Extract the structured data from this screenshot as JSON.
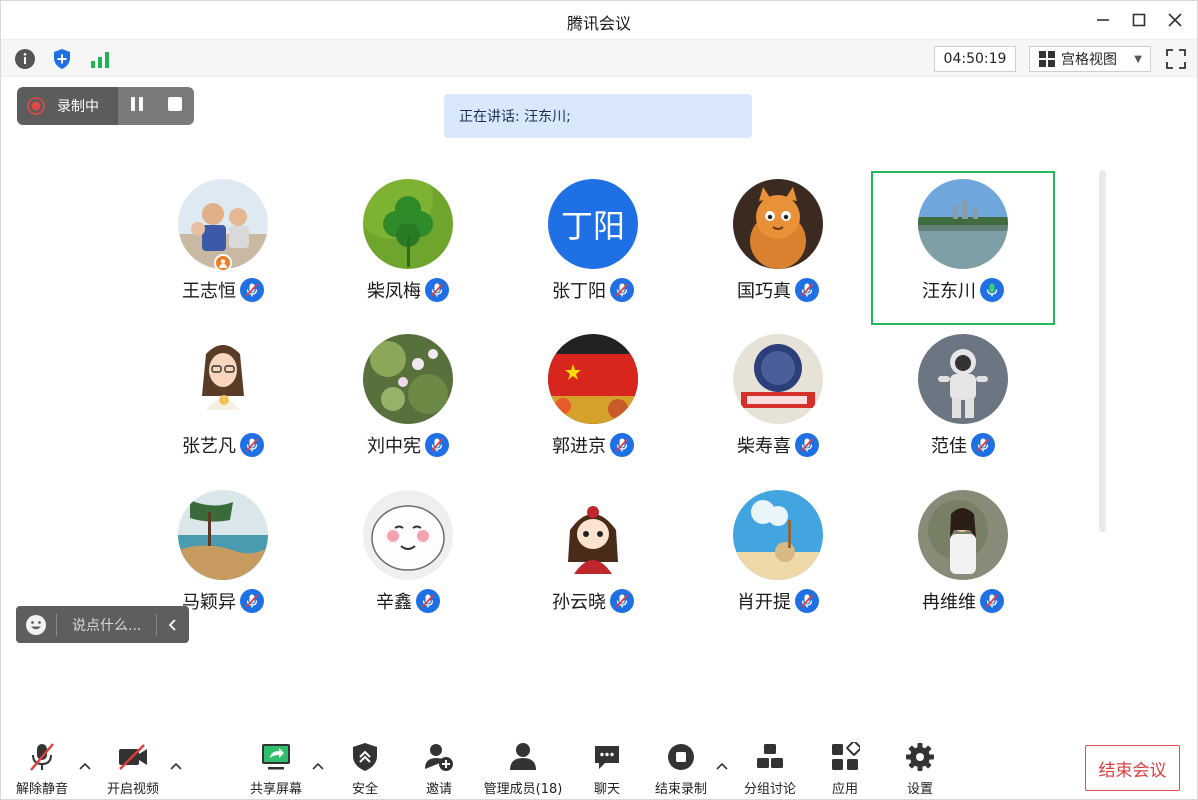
{
  "window": {
    "title": "腾讯会议"
  },
  "toolbar": {
    "timer": "04:50:19",
    "view_mode": "宫格视图"
  },
  "recording": {
    "label": "录制中"
  },
  "speaking": {
    "text": "正在讲话: 汪东川;"
  },
  "participants": [
    {
      "name": "王志恒",
      "avatar": "family-photo",
      "host": true,
      "speaking": false
    },
    {
      "name": "柴凤梅",
      "avatar": "clover",
      "host": false,
      "speaking": false
    },
    {
      "name": "张丁阳",
      "avatar": "text-avatar",
      "avatar_text": "丁阳",
      "host": false,
      "speaking": false
    },
    {
      "name": "国巧真",
      "avatar": "cartoon-cat",
      "host": false,
      "speaking": false
    },
    {
      "name": "汪东川",
      "avatar": "lake-photo",
      "host": false,
      "speaking": true
    },
    {
      "name": "张艺凡",
      "avatar": "cartoon-girl",
      "host": false,
      "speaking": false
    },
    {
      "name": "刘中宪",
      "avatar": "lily-pond",
      "host": false,
      "speaking": false
    },
    {
      "name": "郭进京",
      "avatar": "flag-photo",
      "host": false,
      "speaking": false
    },
    {
      "name": "柴寿喜",
      "avatar": "university-badge",
      "host": false,
      "speaking": false
    },
    {
      "name": "范佳",
      "avatar": "astronaut",
      "host": false,
      "speaking": false
    },
    {
      "name": "马颖异",
      "avatar": "seaside-painting",
      "host": false,
      "speaking": false
    },
    {
      "name": "辛鑫",
      "avatar": "cartoon-face",
      "host": false,
      "speaking": false
    },
    {
      "name": "孙云晓",
      "avatar": "chibi-girl",
      "host": false,
      "speaking": false
    },
    {
      "name": "肖开提",
      "avatar": "sky-cartoon",
      "host": false,
      "speaking": false
    },
    {
      "name": "冉维维",
      "avatar": "woman-photo",
      "host": false,
      "speaking": false
    }
  ],
  "chat": {
    "placeholder": "说点什么..."
  },
  "bottom": {
    "unmute": "解除静音",
    "start_video": "开启视频",
    "share_screen": "共享屏幕",
    "security": "安全",
    "invite": "邀请",
    "manage_members": "管理成员(18)",
    "chat": "聊天",
    "end_recording": "结束录制",
    "breakout": "分组讨论",
    "apps": "应用",
    "settings": "设置",
    "end_meeting": "结束会议"
  },
  "colors": {
    "accent": "#1f6fe5",
    "speaking_border": "#1fb85d",
    "danger": "#e03c3c"
  }
}
